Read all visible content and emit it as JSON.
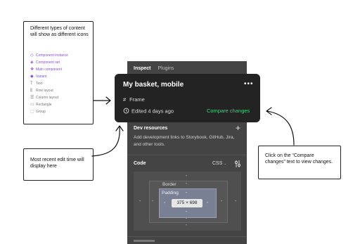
{
  "inspector": {
    "tab_inspect": "Inspect",
    "tab_plugins": "Plugins",
    "dev_resources_title": "Dev resources",
    "dev_resources_text": "Add development links to Storybook, GitHub, Jira, and other tools.",
    "code_title": "Code",
    "code_lang": "CSS",
    "box_model": {
      "border_label": "Border",
      "padding_label": "Padding",
      "size": "375 × 698",
      "dash": "-"
    }
  },
  "card": {
    "title": "My basket, mobile",
    "frame_label": "Frame",
    "edited": "Edited 4 days ago",
    "compare_link": "Compare changes"
  },
  "callouts": {
    "icons": {
      "text": "Different types of content will show as different icons",
      "items": [
        {
          "label": "Component instance",
          "icon": "diamond-outline-icon",
          "color": "#8a4fd8"
        },
        {
          "label": "Component set",
          "icon": "diamond-dashed-icon",
          "color": "#8a4fd8"
        },
        {
          "label": "Main component",
          "icon": "four-diamond-icon",
          "color": "#8a4fd8"
        },
        {
          "label": "Variant",
          "icon": "diamond-filled-icon",
          "color": "#8a4fd8"
        },
        {
          "label": "Text",
          "icon": "text-icon",
          "color": "#777777"
        },
        {
          "label": "Row layout",
          "icon": "row-layout-icon",
          "color": "#777777"
        },
        {
          "label": "Column layout",
          "icon": "column-layout-icon",
          "color": "#777777"
        },
        {
          "label": "Rectangle",
          "icon": "rectangle-icon",
          "color": "#777777"
        },
        {
          "label": "Group",
          "icon": "group-icon",
          "color": "#777777"
        }
      ]
    },
    "edit_time": "Most recent edit time will display here",
    "compare": "Click on the “Compare changes” text to view changes."
  }
}
